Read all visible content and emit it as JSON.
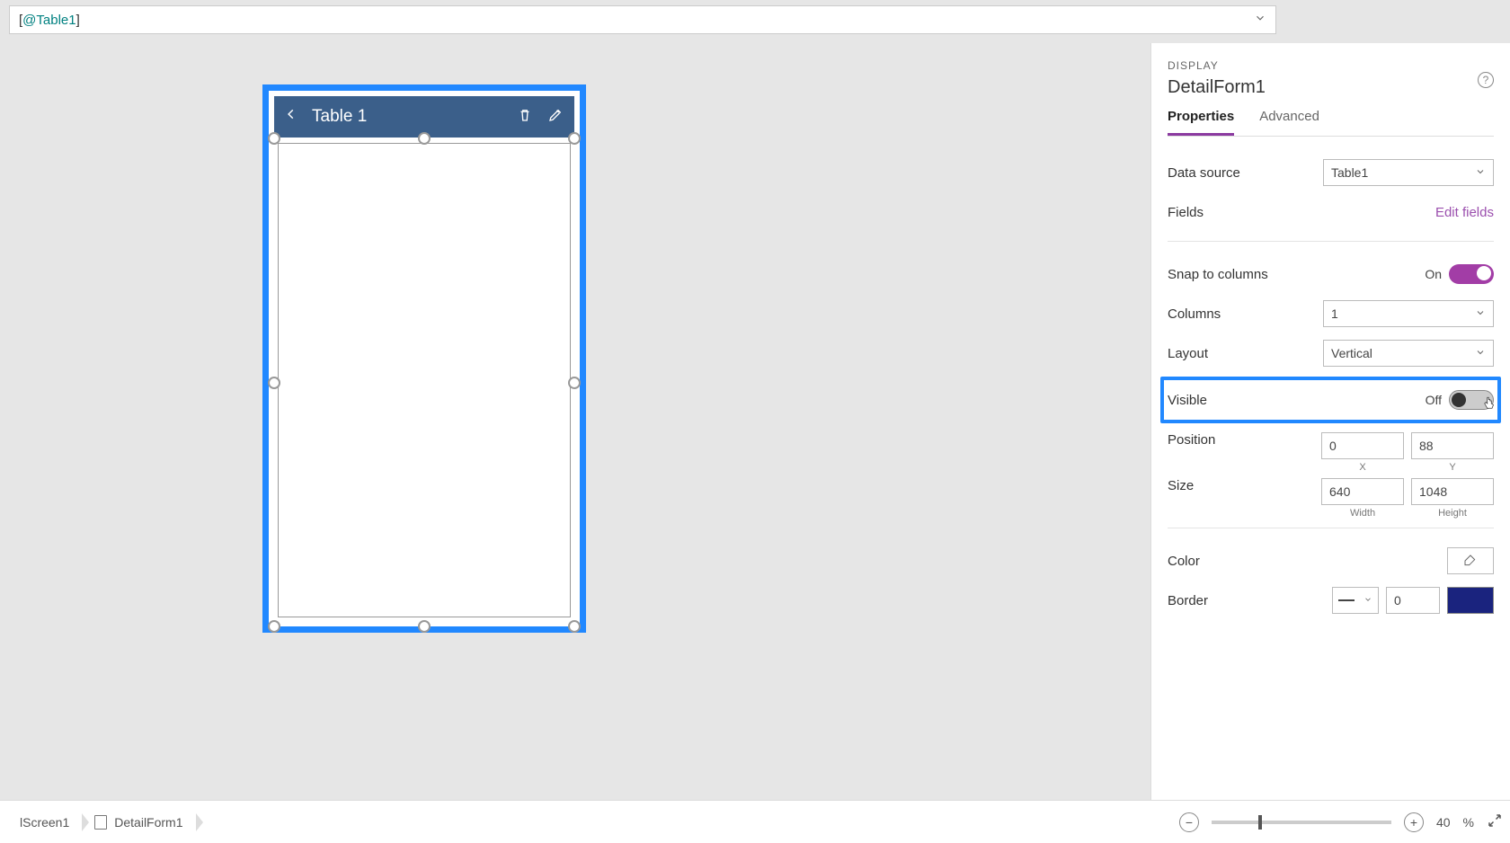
{
  "formula": {
    "open_bracket": "[",
    "at": "@",
    "table_name": "Table1",
    "close_bracket": "]"
  },
  "canvas": {
    "header_title": "Table 1"
  },
  "panel": {
    "section": "DISPLAY",
    "object_name": "DetailForm1",
    "tabs": {
      "properties": "Properties",
      "advanced": "Advanced"
    },
    "data_source": {
      "label": "Data source",
      "value": "Table1"
    },
    "fields": {
      "label": "Fields",
      "link": "Edit fields"
    },
    "snap": {
      "label": "Snap to columns",
      "state": "On"
    },
    "columns": {
      "label": "Columns",
      "value": "1"
    },
    "layout": {
      "label": "Layout",
      "value": "Vertical"
    },
    "visible": {
      "label": "Visible",
      "state": "Off"
    },
    "position": {
      "label": "Position",
      "x": "0",
      "y": "88",
      "x_label": "X",
      "y_label": "Y"
    },
    "size": {
      "label": "Size",
      "w": "640",
      "h": "1048",
      "w_label": "Width",
      "h_label": "Height"
    },
    "color": {
      "label": "Color"
    },
    "border": {
      "label": "Border",
      "value": "0",
      "color": "#1a237e"
    }
  },
  "statusbar": {
    "crumb1": "lScreen1",
    "crumb2": "DetailForm1",
    "zoom": "40",
    "zoom_unit": "%"
  }
}
